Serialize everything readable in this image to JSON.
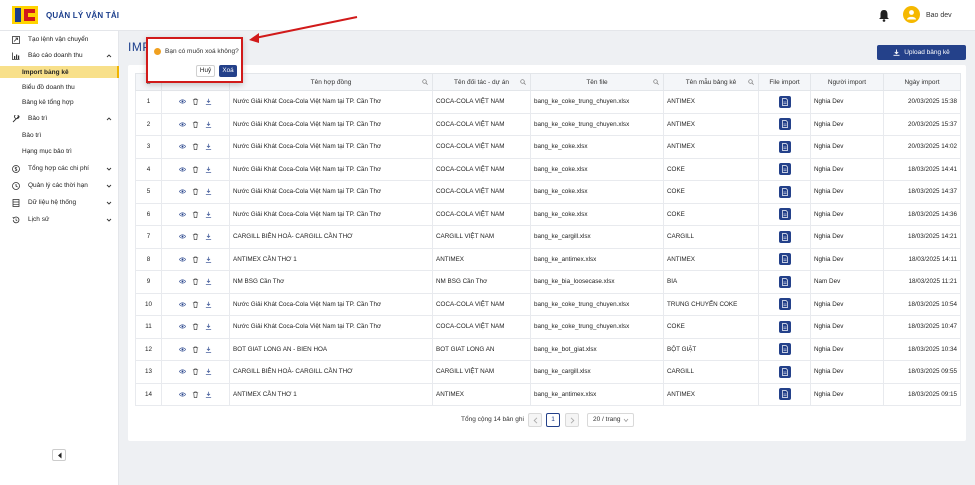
{
  "app": {
    "title": "QUẢN LÝ VẬN TẢI",
    "user_name": "Bao dev"
  },
  "sidebar": {
    "items": [
      {
        "label": "Tạo lệnh vận chuyển",
        "icon": "plus-square-icon"
      },
      {
        "label": "Báo cáo doanh thu",
        "icon": "bar-chart-icon",
        "expanded": true
      },
      {
        "label": "Bảo trì",
        "icon": "wrench-icon",
        "expanded": true
      },
      {
        "label": "Tổng hợp các chi phí",
        "icon": "dollar-icon"
      },
      {
        "label": "Quản lý các thời hạn",
        "icon": "clock-icon"
      },
      {
        "label": "Dữ liệu hệ thống",
        "icon": "database-icon"
      },
      {
        "label": "Lịch sử",
        "icon": "history-icon"
      }
    ],
    "report_sub": [
      "Import bảng kê",
      "Biểu đồ doanh thu",
      "Bảng kê tổng hợp"
    ],
    "maintenance_sub": [
      "Bảo trì",
      "Hạng mục bảo trì"
    ]
  },
  "page": {
    "title": "IMP",
    "upload_label": "Upload bảng kê"
  },
  "table": {
    "headers": {
      "stt": "S",
      "contract": "Tên hợp đồng",
      "partner": "Tên đối tác - dự án",
      "file": "Tên file",
      "template": "Tên mẫu bảng kê",
      "file_import": "File import",
      "importer": "Người import",
      "date": "Ngày import"
    },
    "rows": [
      [
        "1",
        "Nước Giải Khát Coca-Cola Việt Nam tại TP. Cần Thơ",
        "COCA-COLA VIỆT NAM",
        "bang_ke_coke_trung_chuyen.xlsx",
        "ANTIMEX",
        "Nghia Dev",
        "20/03/2025 15:38"
      ],
      [
        "2",
        "Nước Giải Khát Coca-Cola Việt Nam tại TP. Cần Thơ",
        "COCA-COLA VIỆT NAM",
        "bang_ke_coke_trung_chuyen.xlsx",
        "ANTIMEX",
        "Nghia Dev",
        "20/03/2025 15:37"
      ],
      [
        "3",
        "Nước Giải Khát Coca-Cola Việt Nam tại TP. Cần Thơ",
        "COCA-COLA VIỆT NAM",
        "bang_ke_coke.xlsx",
        "ANTIMEX",
        "Nghia Dev",
        "20/03/2025 14:02"
      ],
      [
        "4",
        "Nước Giải Khát Coca-Cola Việt Nam tại TP. Cần Thơ",
        "COCA-COLA VIỆT NAM",
        "bang_ke_coke.xlsx",
        "COKE",
        "Nghia Dev",
        "18/03/2025 14:41"
      ],
      [
        "5",
        "Nước Giải Khát Coca-Cola Việt Nam tại TP. Cần Thơ",
        "COCA-COLA VIỆT NAM",
        "bang_ke_coke.xlsx",
        "COKE",
        "Nghia Dev",
        "18/03/2025 14:37"
      ],
      [
        "6",
        "Nước Giải Khát Coca-Cola Việt Nam tại TP. Cần Thơ",
        "COCA-COLA VIỆT NAM",
        "bang_ke_coke.xlsx",
        "COKE",
        "Nghia Dev",
        "18/03/2025 14:36"
      ],
      [
        "7",
        "CARGILL BIÊN HOÀ- CARGILL CẦN THƠ",
        "CARGILL VIỆT NAM",
        "bang_ke_cargill.xlsx",
        "CARGILL",
        "Nghia Dev",
        "18/03/2025 14:21"
      ],
      [
        "8",
        "ANTIMEX CẦN THƠ 1",
        "ANTIMEX",
        "bang_ke_antimex.xlsx",
        "ANTIMEX",
        "Nghia Dev",
        "18/03/2025 14:11"
      ],
      [
        "9",
        "NM BSG Cần Thơ",
        "NM BSG Cần Thơ",
        "bang_ke_bia_loosecase.xlsx",
        "BIA",
        "Nam Dev",
        "18/03/2025 11:21"
      ],
      [
        "10",
        "Nước Giải Khát Coca-Cola Việt Nam tại TP. Cần Thơ",
        "COCA-COLA VIỆT NAM",
        "bang_ke_coke_trung_chuyen.xlsx",
        "TRUNG CHUYỂN COKE",
        "Nghia Dev",
        "18/03/2025 10:54"
      ],
      [
        "11",
        "Nước Giải Khát Coca-Cola Việt Nam tại TP. Cần Thơ",
        "COCA-COLA VIỆT NAM",
        "bang_ke_coke_trung_chuyen.xlsx",
        "COKE",
        "Nghia Dev",
        "18/03/2025 10:47"
      ],
      [
        "12",
        "BOT GIAT LONG AN - BIEN HOA",
        "BOT GIAT LONG AN",
        "bang_ke_bot_giat.xlsx",
        "BỘT GIẶT",
        "Nghia Dev",
        "18/03/2025 10:34"
      ],
      [
        "13",
        "CARGILL BIÊN HOÀ- CARGILL CẦN THƠ",
        "CARGILL VIỆT NAM",
        "bang_ke_cargill.xlsx",
        "CARGILL",
        "Nghia Dev",
        "18/03/2025 09:55"
      ],
      [
        "14",
        "ANTIMEX CẦN THƠ 1",
        "ANTIMEX",
        "bang_ke_antimex.xlsx",
        "ANTIMEX",
        "Nghia Dev",
        "18/03/2025 09:15"
      ]
    ]
  },
  "pagination": {
    "total": "Tổng cộng 14 bản ghi",
    "current": "1",
    "page_size": "20 / trang"
  },
  "popconfirm": {
    "message": "Bạn có muốn xoá không?",
    "cancel": "Huỷ",
    "ok": "Xoá"
  },
  "colors": {
    "primary": "#24418a",
    "active": "#f8e08a",
    "highlight": "#d11a1a",
    "warning": "#f0a020"
  }
}
